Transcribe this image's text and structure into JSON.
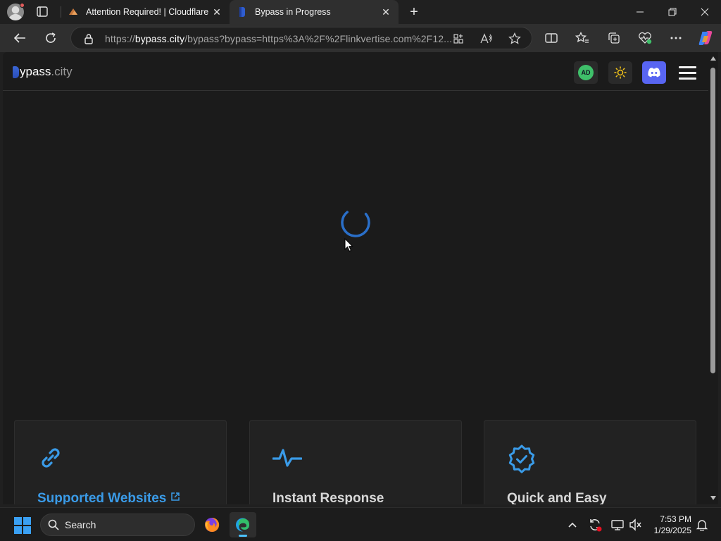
{
  "browser": {
    "tabs": [
      {
        "title": "Attention Required! | Cloudflare",
        "active": false
      },
      {
        "title": "Bypass in Progress",
        "active": true
      }
    ],
    "address": {
      "scheme": "https://",
      "host": "bypass.city",
      "path": "/bypass?bypass=https%3A%2F%2Flinkvertise.com%2F12..."
    }
  },
  "site": {
    "logo_text": "ypass",
    "logo_dot": ".",
    "logo_domain": "city",
    "ad_badge": "AD",
    "cards": [
      {
        "title": "Supported Websites",
        "is_link": true
      },
      {
        "title": "Instant Response",
        "is_link": false
      },
      {
        "title": "Quick and Easy",
        "is_link": false
      }
    ],
    "colors": {
      "accent": "#3a9be8",
      "discord": "#5865f2",
      "ad_green": "#3fc06a"
    }
  },
  "taskbar": {
    "search_label": "Search",
    "time": "7:53 PM",
    "date": "1/29/2025"
  }
}
